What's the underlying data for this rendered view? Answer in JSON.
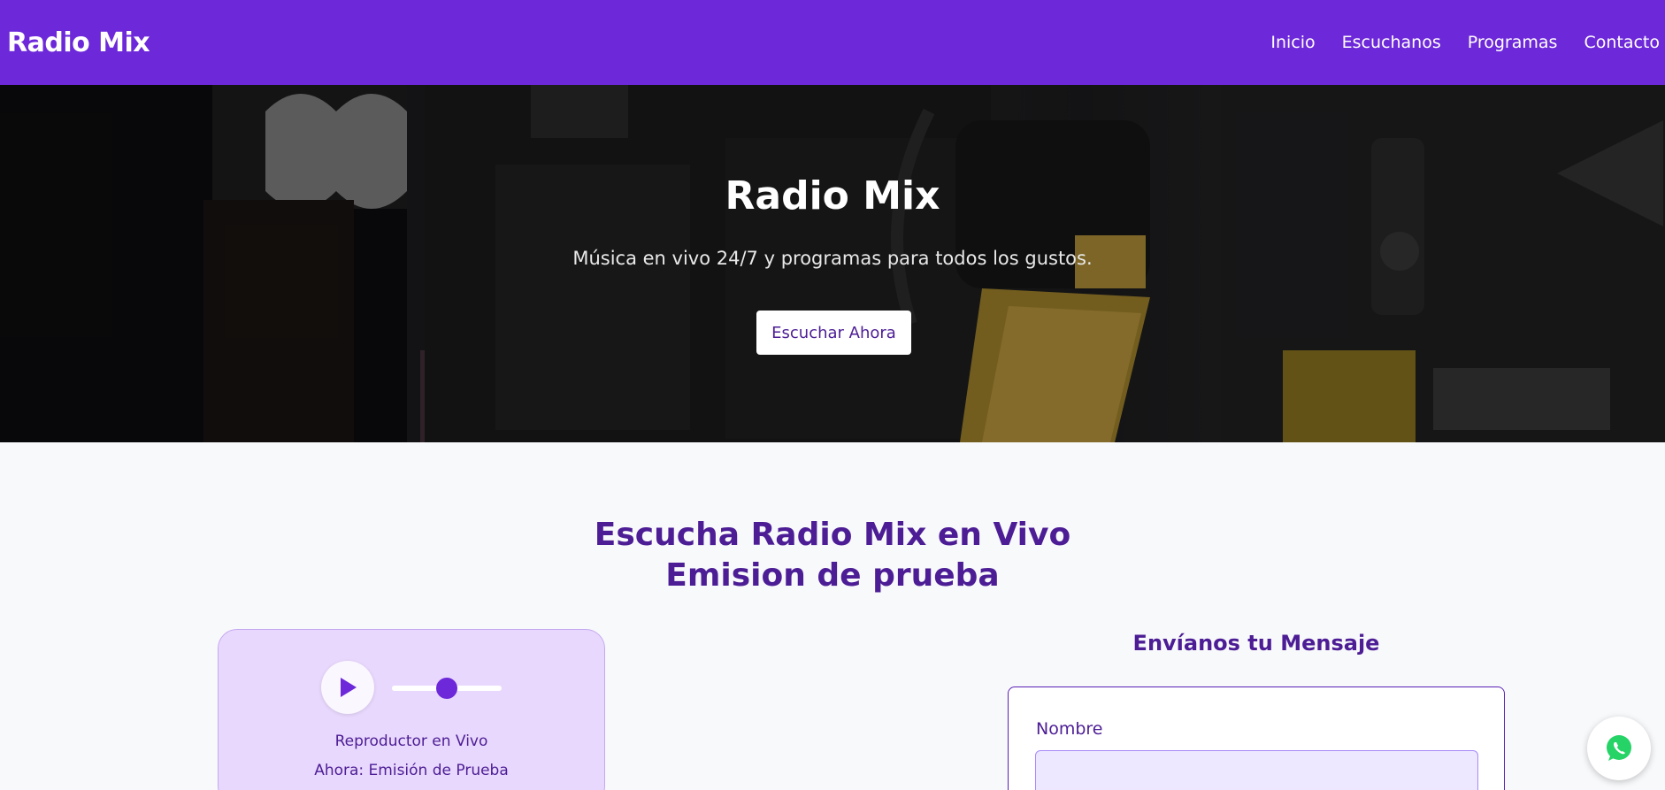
{
  "colors": {
    "navbar": "#6d28d9",
    "accent_dark": "#4c1d95",
    "player_card": "#e9d8fd",
    "page_bg": "#f8f9fb",
    "whatsapp": "#25d366"
  },
  "navbar": {
    "brand": "Radio Mix",
    "links": [
      "Inicio",
      "Escuchanos",
      "Programas",
      "Contacto"
    ]
  },
  "hero": {
    "title": "Radio Mix",
    "subtitle": "Música en vivo 24/7 y programas para todos los gustos.",
    "button_label": "Escuchar Ahora",
    "background_icon": "microphone-studio-photo"
  },
  "listen": {
    "title_line1": "Escucha Radio Mix en Vivo",
    "title_line2": "Emision de prueba"
  },
  "player": {
    "play_icon": "play-icon",
    "volume_level": 0.5,
    "label": "Reproductor en Vivo",
    "now_playing": "Ahora: Emisión de Prueba"
  },
  "contact": {
    "title": "Envíanos tu Mensaje",
    "name_label": "Nombre"
  },
  "fab": {
    "icon": "whatsapp-icon"
  }
}
